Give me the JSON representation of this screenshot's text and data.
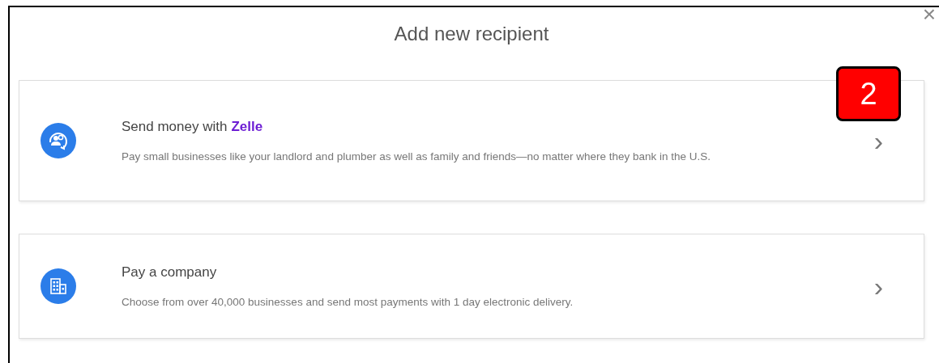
{
  "dialog": {
    "title": "Add new recipient",
    "close": "×"
  },
  "options": [
    {
      "kind": "zelle",
      "title": "Send money with",
      "brand": "Zelle",
      "description": "Pay small businesses like your landlord and plumber as well as family and friends—no matter where they bank in the U.S.",
      "chevron": "›"
    },
    {
      "kind": "company",
      "title": "Pay a company",
      "description": "Choose from over 40,000 businesses and send most payments with 1 day electronic delivery.",
      "chevron": "›"
    }
  ],
  "callout": {
    "label": "2"
  }
}
